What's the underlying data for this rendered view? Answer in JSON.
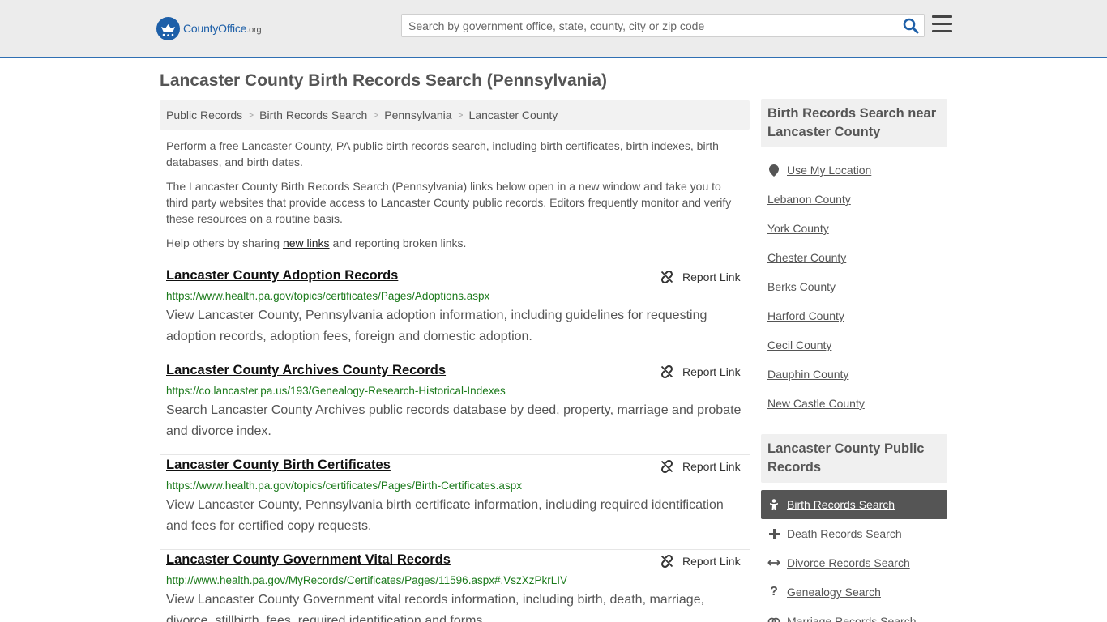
{
  "header": {
    "logo_main": "CountyOffice",
    "logo_suffix": ".org",
    "search_placeholder": "Search by government office, state, county, city or zip code"
  },
  "page_title": "Lancaster County Birth Records Search (Pennsylvania)",
  "breadcrumb": [
    "Public Records",
    "Birth Records Search",
    "Pennsylvania",
    "Lancaster County"
  ],
  "intro": {
    "p1": "Perform a free Lancaster County, PA public birth records search, including birth certificates, birth indexes, birth databases, and birth dates.",
    "p2": "The Lancaster County Birth Records Search (Pennsylvania) links below open in a new window and take you to third party websites that provide access to Lancaster County public records. Editors frequently monitor and verify these resources on a routine basis.",
    "p3_before": "Help others by sharing ",
    "p3_link": "new links",
    "p3_after": " and reporting broken links."
  },
  "report_label": "Report Link",
  "records": [
    {
      "title": "Lancaster County Adoption Records",
      "url": "https://www.health.pa.gov/topics/certificates/Pages/Adoptions.aspx",
      "desc": "View Lancaster County, Pennsylvania adoption information, including guidelines for requesting adoption records, adoption fees, foreign and domestic adoption."
    },
    {
      "title": "Lancaster County Archives County Records",
      "url": "https://co.lancaster.pa.us/193/Genealogy-Research-Historical-Indexes",
      "desc": "Search Lancaster County Archives public records database by deed, property, marriage and probate and divorce index."
    },
    {
      "title": "Lancaster County Birth Certificates",
      "url": "https://www.health.pa.gov/topics/certificates/Pages/Birth-Certificates.aspx",
      "desc": "View Lancaster County, Pennsylvania birth certificate information, including required identification and fees for certified copy requests."
    },
    {
      "title": "Lancaster County Government Vital Records",
      "url": "http://www.health.pa.gov/MyRecords/Certificates/Pages/11596.aspx#.VszXzPkrLIV",
      "desc": "View Lancaster County Government vital records information, including birth, death, marriage, divorce, stillbirth, fees, required identification and forms."
    }
  ],
  "sidebar": {
    "nearby_title": "Birth Records Search near Lancaster County",
    "use_location": "Use My Location",
    "nearby": [
      "Lebanon County",
      "York County",
      "Chester County",
      "Berks County",
      "Harford County",
      "Cecil County",
      "Dauphin County",
      "New Castle County"
    ],
    "public_title": "Lancaster County Public Records",
    "public": [
      {
        "label": "Birth Records Search",
        "icon": "baby-icon",
        "active": true
      },
      {
        "label": "Death Records Search",
        "icon": "cross-icon",
        "active": false
      },
      {
        "label": "Divorce Records Search",
        "icon": "arrows-split-icon",
        "active": false
      },
      {
        "label": "Genealogy Search",
        "icon": "question-icon",
        "active": false
      },
      {
        "label": "Marriage Records Search",
        "icon": "rings-icon",
        "active": false
      }
    ]
  },
  "colors": {
    "accent": "#1d5fa8",
    "url_green": "#1b7a1b",
    "active_bg": "#555555"
  }
}
